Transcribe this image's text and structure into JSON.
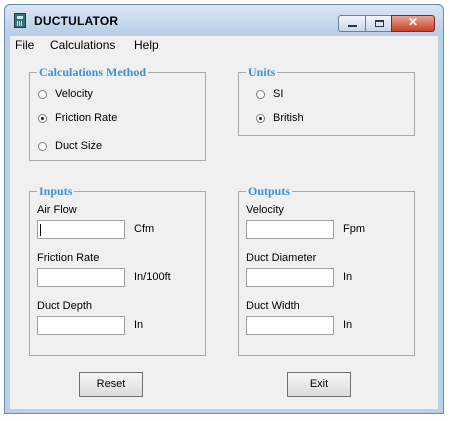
{
  "window": {
    "title": "DUCTULATOR",
    "icon": "calculator-icon"
  },
  "titlebar_buttons": {
    "minimize": "minimize-icon",
    "maximize": "maximize-icon",
    "close": "✕"
  },
  "menu": [
    "File",
    "Calculations",
    "Help"
  ],
  "calc_method": {
    "legend": "Calculations Method",
    "options": [
      {
        "label": "Velocity",
        "selected": false
      },
      {
        "label": "Friction Rate",
        "selected": true
      },
      {
        "label": "Duct Size",
        "selected": false
      }
    ]
  },
  "units": {
    "legend": "Units",
    "options": [
      {
        "label": "SI",
        "selected": false
      },
      {
        "label": "British",
        "selected": true
      }
    ]
  },
  "inputs": {
    "legend": "Inputs",
    "fields": [
      {
        "label": "Air Flow",
        "value": "",
        "unit": "Cfm"
      },
      {
        "label": "Friction Rate",
        "value": "",
        "unit": "In/100ft"
      },
      {
        "label": "Duct Depth",
        "value": "",
        "unit": "In"
      }
    ]
  },
  "outputs": {
    "legend": "Outputs",
    "fields": [
      {
        "label": "Velocity",
        "value": "",
        "unit": "Fpm"
      },
      {
        "label": "Duct Diameter",
        "value": "",
        "unit": "In"
      },
      {
        "label": "Duct Width",
        "value": "",
        "unit": "In"
      }
    ]
  },
  "buttons": {
    "reset": "Reset",
    "exit": "Exit"
  }
}
